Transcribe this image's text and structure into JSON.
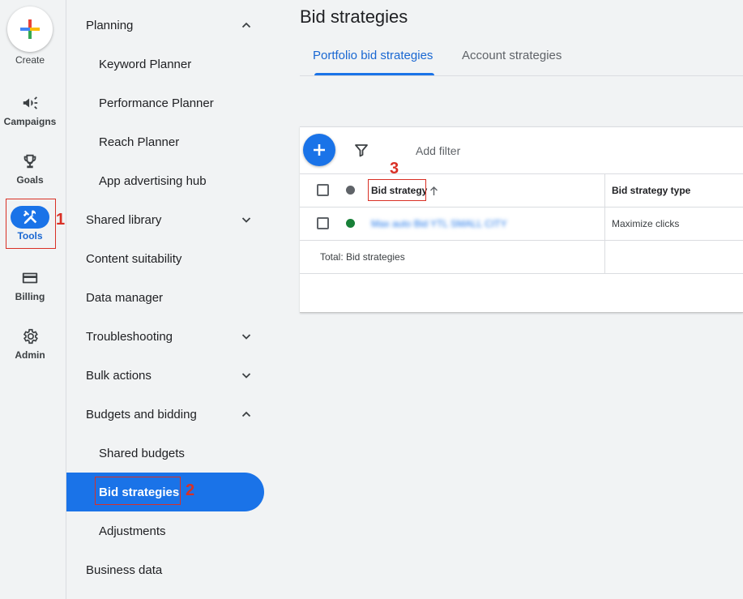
{
  "rail": {
    "create_label": "Create",
    "items": [
      {
        "label": "Campaigns",
        "icon": "campaigns-icon"
      },
      {
        "label": "Goals",
        "icon": "trophy-icon"
      },
      {
        "label": "Tools",
        "icon": "tools-icon"
      },
      {
        "label": "Billing",
        "icon": "credit-card-icon"
      },
      {
        "label": "Admin",
        "icon": "gear-icon"
      }
    ]
  },
  "drawer": {
    "items": [
      {
        "label": "Planning"
      },
      {
        "label": "Keyword Planner"
      },
      {
        "label": "Performance Planner"
      },
      {
        "label": "Reach Planner"
      },
      {
        "label": "App advertising hub"
      },
      {
        "label": "Shared library"
      },
      {
        "label": "Content suitability"
      },
      {
        "label": "Data manager"
      },
      {
        "label": "Troubleshooting"
      },
      {
        "label": "Bulk actions"
      },
      {
        "label": "Budgets and bidding"
      },
      {
        "label": "Shared budgets"
      },
      {
        "label": "Bid strategies"
      },
      {
        "label": "Adjustments"
      },
      {
        "label": "Business data"
      }
    ]
  },
  "main": {
    "title": "Bid strategies",
    "tabs": [
      {
        "label": "Portfolio bid strategies"
      },
      {
        "label": "Account strategies"
      }
    ],
    "toolbar": {
      "add_filter": "Add filter"
    },
    "table": {
      "headers": {
        "bid_strategy": "Bid strategy",
        "bid_strategy_type": "Bid strategy type"
      },
      "rows": [
        {
          "name": "Max auto Bid YTL SMALL CITY",
          "type": "Maximize clicks"
        }
      ],
      "total_label": "Total: Bid strategies"
    }
  },
  "annotations": {
    "one": "1",
    "two": "2",
    "three": "3"
  },
  "colors": {
    "accent": "#1a73e8",
    "annotation": "#d93025",
    "enabled_dot": "#188038"
  }
}
